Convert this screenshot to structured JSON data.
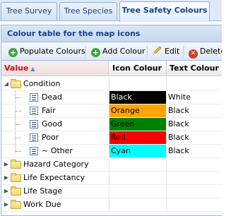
{
  "tabs": [
    {
      "label": "Tree Survey",
      "active": false
    },
    {
      "label": "Tree Species",
      "active": false
    },
    {
      "label": "Tree Safety Colours",
      "active": true
    }
  ],
  "panel": {
    "title": "Colour table for the map icons"
  },
  "toolbar": {
    "populate_label": "Populate Colours",
    "add_label": "Add Colour",
    "edit_label": "Edit",
    "delete_label": "Delete"
  },
  "grid": {
    "columns": [
      "Value",
      "Icon Colour",
      "Text Colour"
    ],
    "sort_column": "Value",
    "sort_direction": "ascending",
    "groups": [
      {
        "label": "Condition",
        "expanded": true,
        "children": [
          {
            "label": "Dead",
            "icon_colour": "Black",
            "icon_colour_hex": "#000000",
            "icon_text_hex": "#ffffff",
            "text_colour": "White"
          },
          {
            "label": "Fair",
            "icon_colour": "Orange",
            "icon_colour_hex": "#ffa500",
            "icon_text_hex": "#000000",
            "text_colour": "Black"
          },
          {
            "label": "Good",
            "icon_colour": "Green",
            "icon_colour_hex": "#008000",
            "icon_text_hex": "#000000",
            "text_colour": "Black"
          },
          {
            "label": "Poor",
            "icon_colour": "Red",
            "icon_colour_hex": "#ff0000",
            "icon_text_hex": "#000000",
            "text_colour": "Black"
          },
          {
            "label": "~ Other",
            "icon_colour": "Cyan",
            "icon_colour_hex": "#00ffff",
            "icon_text_hex": "#000000",
            "text_colour": "Black"
          }
        ]
      },
      {
        "label": "Hazard Category",
        "expanded": false
      },
      {
        "label": "Life Expectancy",
        "expanded": false
      },
      {
        "label": "Life Stage",
        "expanded": false
      },
      {
        "label": "Work Due",
        "expanded": false
      }
    ]
  },
  "icons": {
    "populate": "add-icon",
    "add": "add-icon",
    "edit": "pencil-icon",
    "delete": "delete-icon",
    "folder": "folder-icon",
    "leaf": "list-document-icon"
  }
}
